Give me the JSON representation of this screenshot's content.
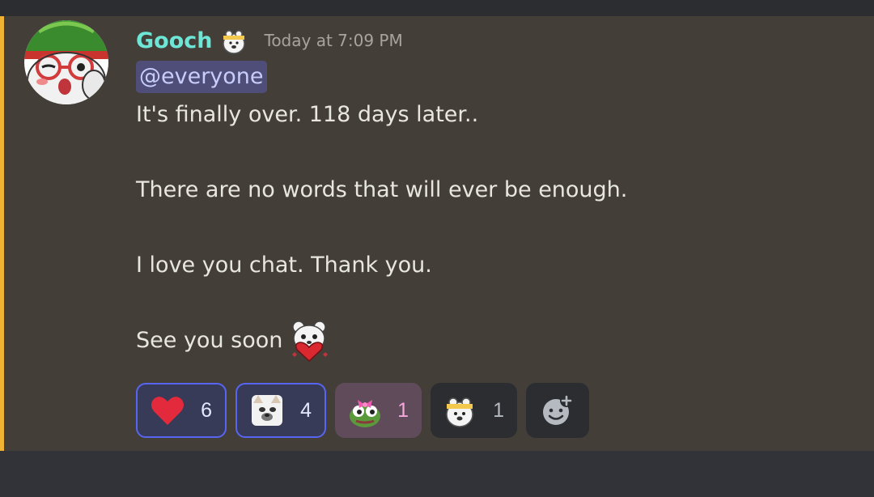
{
  "message": {
    "author": "Gooch",
    "author_color": "#6ee6d6",
    "timestamp": "Today at 7:09 PM",
    "highlight_color": "#f0b232",
    "mention": "@everyone",
    "lines": [
      "It's finally over. 118 days later..",
      "There are no words that will ever be enough.",
      "I love you chat. Thank you.",
      "See you soon"
    ]
  },
  "reactions": [
    {
      "emoji": "red-heart",
      "count": "6",
      "reacted": true
    },
    {
      "emoji": "dog-face-sticker",
      "count": "4",
      "reacted": true
    },
    {
      "emoji": "pepe-frog-bow",
      "count": "1",
      "reacted": false
    },
    {
      "emoji": "bear-headband",
      "count": "1",
      "reacted": false
    }
  ],
  "add_reaction": {
    "icon": "add-reaction-icon"
  }
}
